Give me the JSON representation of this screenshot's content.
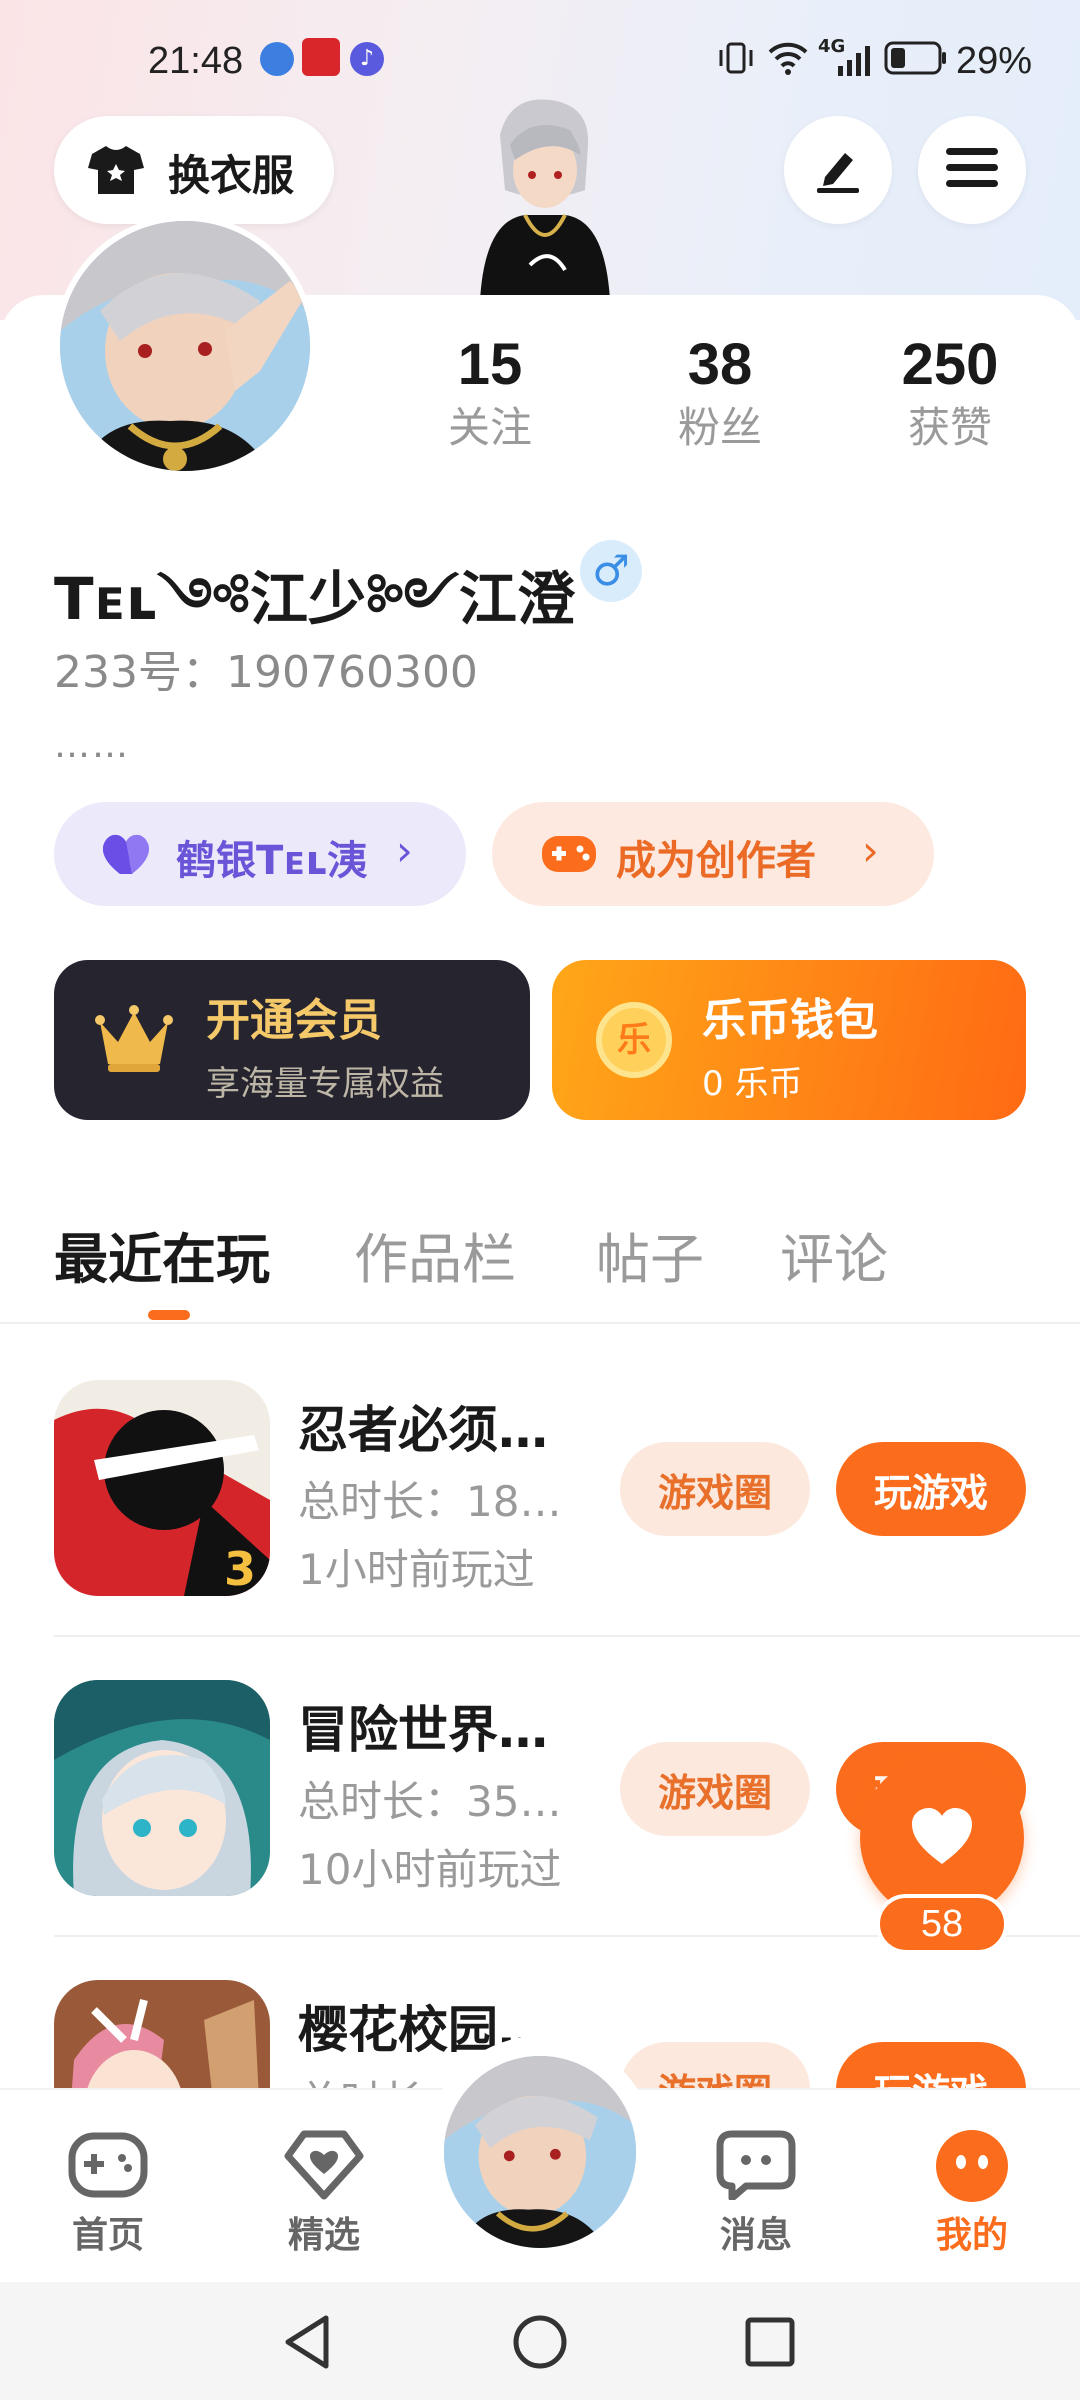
{
  "status_bar": {
    "time": "21:48",
    "battery": "29%",
    "network": "4G"
  },
  "header": {
    "outfit_label": "换衣服"
  },
  "profile": {
    "stats": [
      {
        "value": "15",
        "label": "关注"
      },
      {
        "value": "38",
        "label": "粉丝"
      },
      {
        "value": "250",
        "label": "获赞"
      }
    ],
    "name": "Tᴇʟ༺江少༻江澄",
    "gender": "♂",
    "id_text": "233号：190760300",
    "bio": "……"
  },
  "chips": {
    "guild": "鹤银Tᴇʟ洟",
    "creator": "成为创作者"
  },
  "cards": {
    "vip": {
      "title": "开通会员",
      "subtitle": "享海量专属权益"
    },
    "wallet": {
      "title": "乐币钱包",
      "subtitle": "0 乐币",
      "coin": "乐"
    }
  },
  "tabs": [
    "最近在玩",
    "作品栏",
    "帖子",
    "评论"
  ],
  "games": [
    {
      "name": "忍者必须…",
      "duration": "总时长：18…",
      "last_played": "1小时前玩过",
      "circle": "游戏圈",
      "play": "玩游戏"
    },
    {
      "name": "冒险世界…",
      "duration": "总时长：35…",
      "last_played": "10小时前玩过",
      "circle": "游戏圈",
      "play": "玩游戏"
    },
    {
      "name": "樱花校园…",
      "duration": "总时长…",
      "last_played": "",
      "circle": "游戏圈",
      "play": "玩游戏"
    }
  ],
  "like_float": {
    "count": "58"
  },
  "bottom_nav": [
    {
      "label": "首页"
    },
    {
      "label": "精选"
    },
    {
      "label": ""
    },
    {
      "label": "消息"
    },
    {
      "label": "我的"
    }
  ],
  "colors": {
    "accent": "#fb6d1c",
    "vip_bg": "#25242f",
    "gold": "#f5c96a"
  }
}
